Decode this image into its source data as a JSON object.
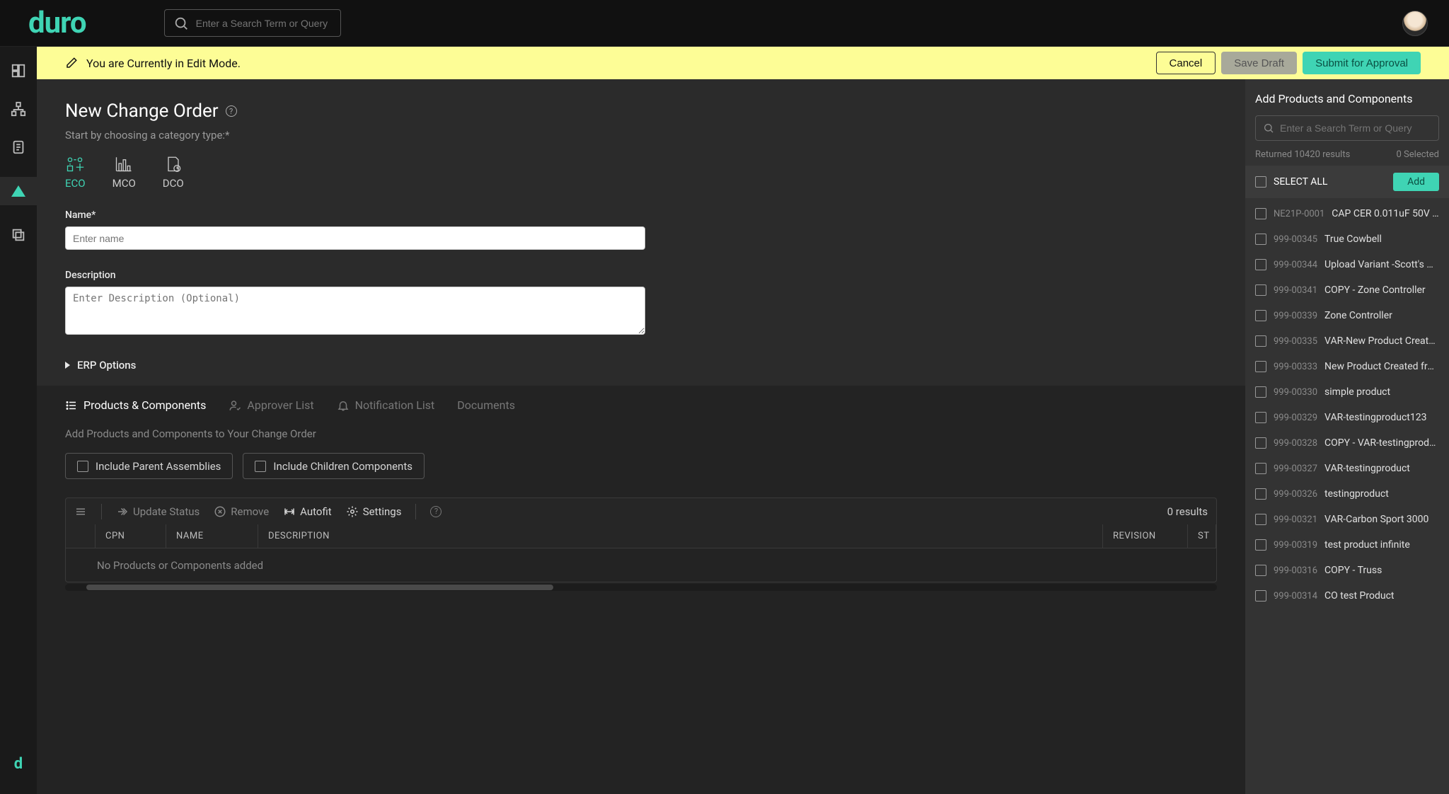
{
  "brand": "duro",
  "top_search_placeholder": "Enter a Search Term or Query",
  "banner": {
    "message": "You are Currently in Edit Mode.",
    "cancel": "Cancel",
    "draft": "Save Draft",
    "submit": "Submit for Approval"
  },
  "page": {
    "title": "New Change Order",
    "instruction": "Start by choosing a category type:*",
    "categories": {
      "eco": "ECO",
      "mco": "MCO",
      "dco": "DCO"
    },
    "name_label": "Name*",
    "name_placeholder": "Enter name",
    "desc_label": "Description",
    "desc_placeholder": "Enter Description (Optional)",
    "erp": "ERP Options"
  },
  "subtabs": {
    "products": "Products & Components",
    "approvers": "Approver List",
    "notify": "Notification List",
    "docs": "Documents"
  },
  "lower": {
    "hint": "Add Products and Components to Your Change Order",
    "chip_parent": "Include Parent Assemblies",
    "chip_children": "Include Children Components",
    "update_status": "Update Status",
    "remove": "Remove",
    "autofit": "Autofit",
    "settings": "Settings",
    "results_meta": "0 results",
    "cols": {
      "cpn": "CPN",
      "name": "NAME",
      "desc": "DESCRIPTION",
      "rev": "REVISION",
      "st": "ST"
    },
    "empty": "No Products or Components added"
  },
  "rp": {
    "title": "Add Products and Components",
    "search_placeholder": "Enter a Search Term or Query",
    "returned": "Returned 10420 results",
    "selected": "0 Selected",
    "select_all": "SELECT ALL",
    "add": "Add",
    "items": [
      {
        "code": "NE21P-0001",
        "name": "CAP CER 0.011uF 50V …"
      },
      {
        "code": "999-00345",
        "name": "True Cowbell"
      },
      {
        "code": "999-00344",
        "name": "Upload Variant -Scott's C…"
      },
      {
        "code": "999-00341",
        "name": "COPY - Zone Controller"
      },
      {
        "code": "999-00339",
        "name": "Zone Controller"
      },
      {
        "code": "999-00335",
        "name": "VAR-New Product Create…"
      },
      {
        "code": "999-00333",
        "name": "New Product Created fro…"
      },
      {
        "code": "999-00330",
        "name": "simple product"
      },
      {
        "code": "999-00329",
        "name": "VAR-testingproduct123"
      },
      {
        "code": "999-00328",
        "name": "COPY - VAR-testingproduct"
      },
      {
        "code": "999-00327",
        "name": "VAR-testingproduct"
      },
      {
        "code": "999-00326",
        "name": "testingproduct"
      },
      {
        "code": "999-00321",
        "name": "VAR-Carbon Sport 3000"
      },
      {
        "code": "999-00319",
        "name": "test product infinite"
      },
      {
        "code": "999-00316",
        "name": "COPY - Truss"
      },
      {
        "code": "999-00314",
        "name": "CO test Product"
      }
    ]
  }
}
